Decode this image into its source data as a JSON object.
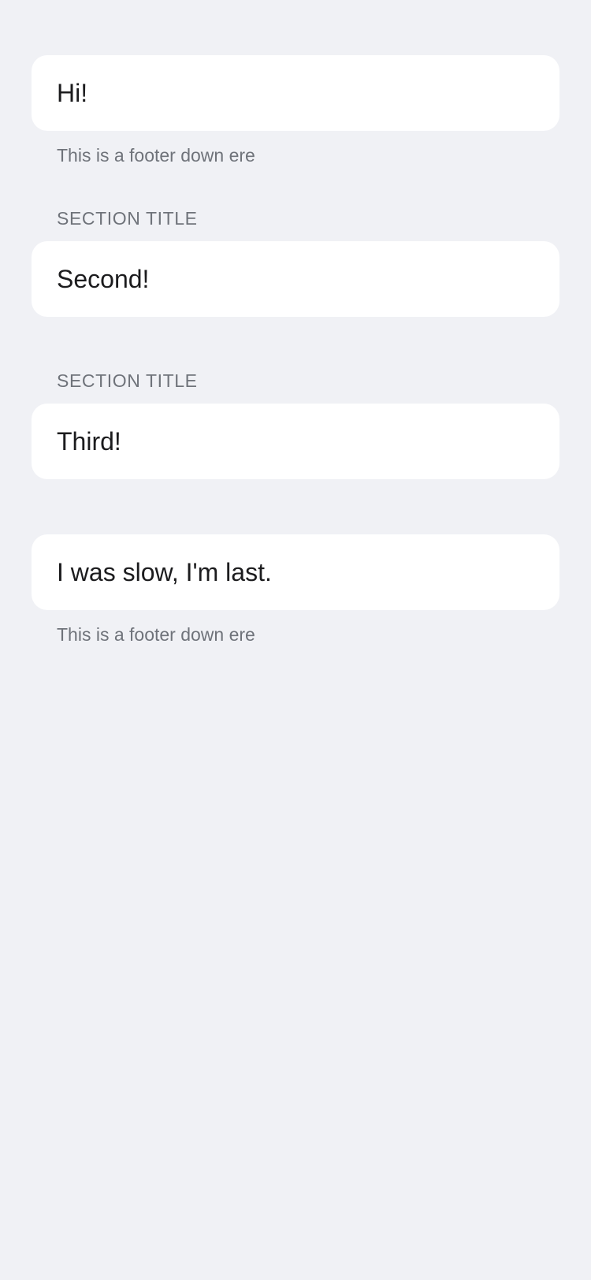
{
  "sections": [
    {
      "header": "",
      "cell": "Hi!",
      "footer": "This is a footer down ere"
    },
    {
      "header": "SECTION TITLE",
      "cell": "Second!",
      "footer": ""
    },
    {
      "header": "SECTION TITLE",
      "cell": "Third!",
      "footer": ""
    },
    {
      "header": "",
      "cell": "I was slow, I'm last.",
      "footer": "This is a footer down ere"
    }
  ]
}
